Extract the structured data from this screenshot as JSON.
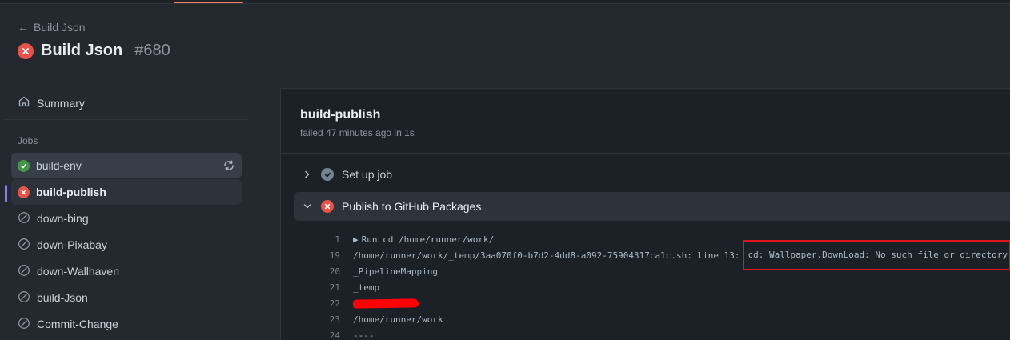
{
  "header": {
    "back_label": "Build Json",
    "title": "Build Json",
    "run_number": "#680"
  },
  "sidebar": {
    "summary_label": "Summary",
    "jobs_heading": "Jobs",
    "jobs": [
      {
        "label": "build-env",
        "status": "success"
      },
      {
        "label": "build-publish",
        "status": "failed"
      },
      {
        "label": "down-bing",
        "status": "skipped"
      },
      {
        "label": "down-Pixabay",
        "status": "skipped"
      },
      {
        "label": "down-Wallhaven",
        "status": "skipped"
      },
      {
        "label": "build-Json",
        "status": "skipped"
      },
      {
        "label": "Commit-Change",
        "status": "skipped"
      }
    ]
  },
  "main": {
    "job_title": "build-publish",
    "job_status": "failed 47 minutes ago in 1s",
    "steps": [
      {
        "label": "Set up job",
        "status": "success",
        "expanded": false
      },
      {
        "label": "Publish to GitHub Packages",
        "status": "failed",
        "expanded": true
      }
    ],
    "log": [
      {
        "num": "1",
        "text": "Run cd /home/runner/work/"
      },
      {
        "num": "19",
        "text": "/home/runner/work/_temp/3aa070f0-b7d2-4dd8-a092-75904317ca1c.sh: line 13:",
        "highlight": "cd: Wallpaper.DownLoad: No such file or directory"
      },
      {
        "num": "20",
        "text": "_PipelineMapping"
      },
      {
        "num": "21",
        "text": "_temp"
      },
      {
        "num": "22",
        "text": ""
      },
      {
        "num": "23",
        "text": "/home/runner/work"
      },
      {
        "num": "24",
        "text": "----"
      }
    ]
  },
  "colors": {
    "failed": "#e5534b",
    "success": "#46954a",
    "accent_tab": "#f78166",
    "selected_bar": "#8c7cf0",
    "annotation_red": "#e0151b"
  },
  "icons": [
    "arrow-left-icon",
    "x-circle-icon",
    "home-icon",
    "check-circle-icon",
    "sync-icon",
    "skipped-icon",
    "chevron-right-icon",
    "chevron-down-icon"
  ]
}
